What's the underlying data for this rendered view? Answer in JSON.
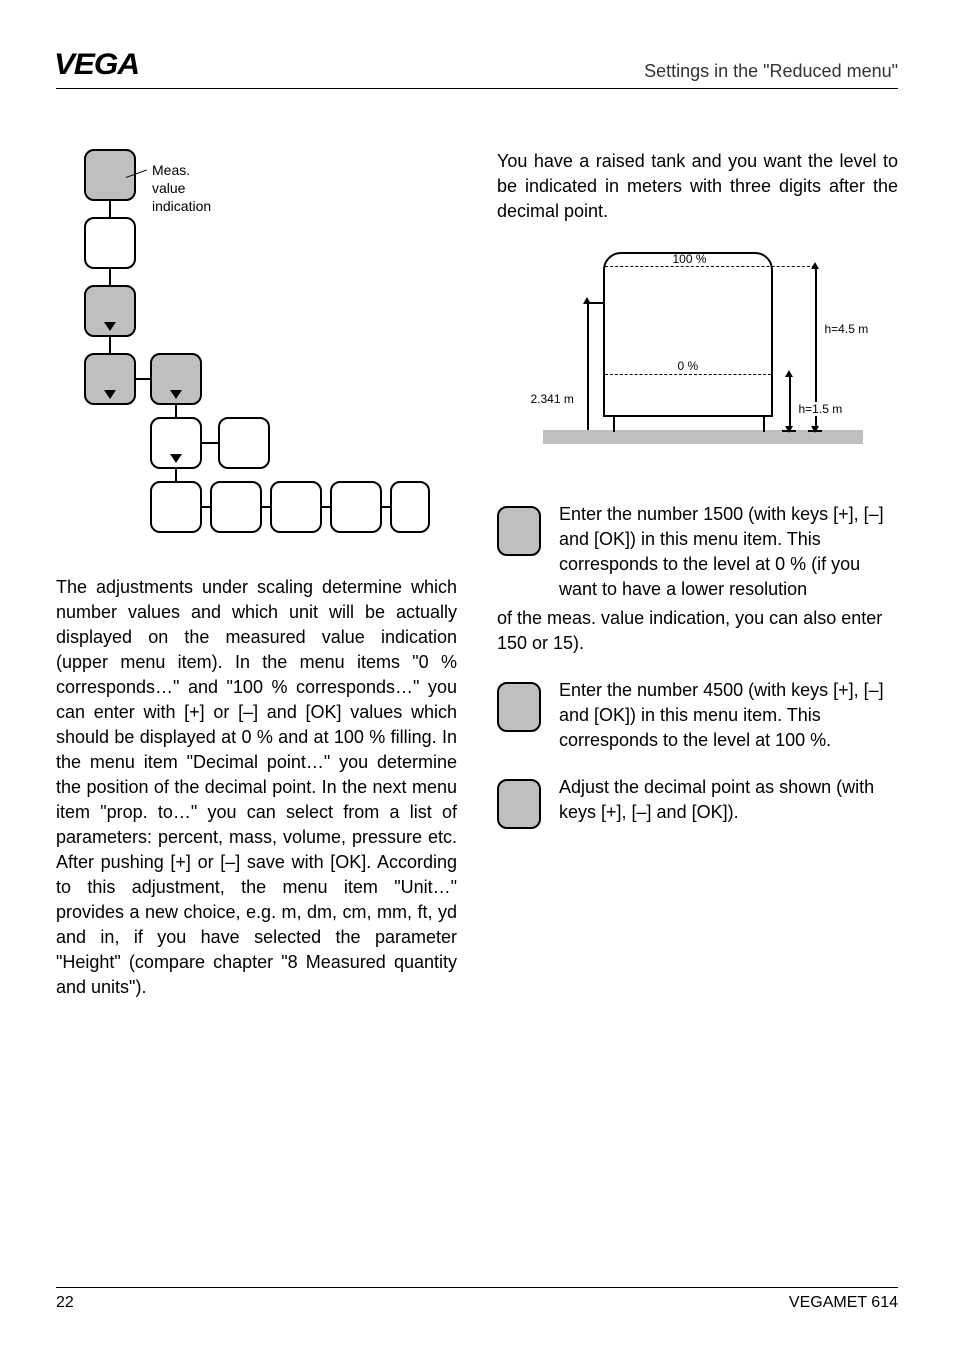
{
  "header": {
    "logo": "VEGA",
    "title": "Settings in the \"Reduced menu\""
  },
  "menuTree": {
    "label_line1": "Meas.",
    "label_line2": "value",
    "label_line3": "indication"
  },
  "leftPara": "The adjustments under scaling determine which number values and which unit will be actually displayed on the measured value indication (upper menu item). In the menu items \"0 % corresponds…\" and \"100 % corresponds…\" you can enter with [+] or [–] and [OK] values which should be displayed at 0 % and at 100 % filling. In the menu item \"Decimal point…\" you determine the position of the decimal point. In the next menu item \"prop. to…\" you can select from a list of parameters: percent, mass, volume, pressure etc. After pushing [+] or [–] save with [OK]. According to this adjustment, the menu item \"Unit…\" provides a new choice, e.g. m, dm, cm, mm, ft, yd and in, if you have selected the parameter \"Height\" (compare chapter \"8 Measured quantity and units\").",
  "rightIntro": "You have a raised tank and you want the level to be indicated in meters with three digits after the decimal point.",
  "tank": {
    "top": "100 %",
    "zero": "0 %",
    "left": "2.341 m",
    "h1": "h=4.5 m",
    "h2": "h=1.5 m"
  },
  "steps": [
    {
      "text": "Enter the number 1500 (with keys [+], [–] and [OK]) in this menu item. This corresponds to the level at 0 % (if you want to have a lower resolution"
    },
    {
      "text": "Enter the number 4500 (with keys [+], [–] and [OK]) in this menu item. This corresponds to the level at 100 %."
    },
    {
      "text": "Adjust the decimal point as shown (with keys [+], [–] and [OK])."
    }
  ],
  "stepCont": "of the meas. value indication, you can also enter 150 or 15).",
  "footer": {
    "page": "22",
    "product": "VEGAMET 614"
  }
}
